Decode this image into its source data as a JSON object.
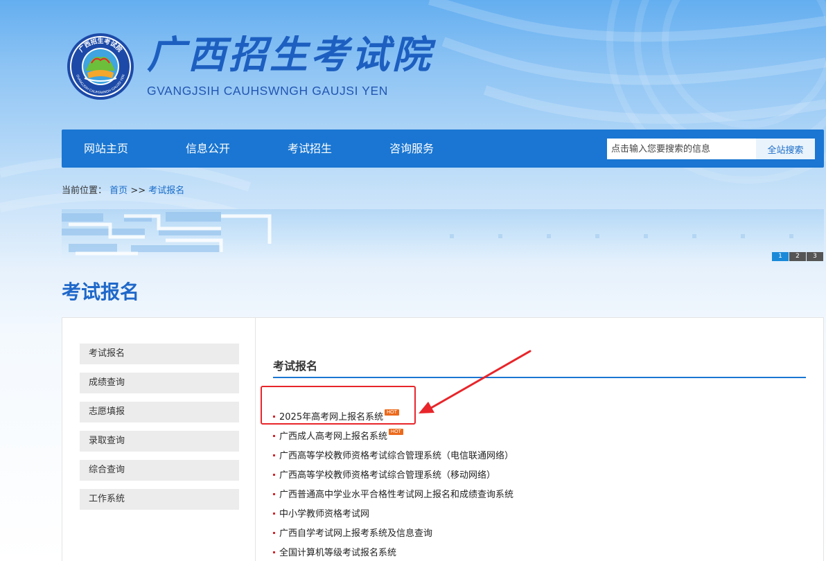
{
  "header": {
    "title": "广西招生考试院",
    "subtitle": "GVANGJSIH CAUHSWNGH GAUJSI YEN",
    "seal_text": "广西招生考试院",
    "seal_sub_text": "GVANGJSIH CAUHSWNGH GAUJSI YEN"
  },
  "nav": {
    "items": [
      {
        "label": "网站主页"
      },
      {
        "label": "信息公开"
      },
      {
        "label": "考试招生"
      },
      {
        "label": "咨询服务"
      }
    ],
    "search_placeholder": "点击输入您要搜索的信息",
    "search_button": "全站搜索"
  },
  "breadcrumb": {
    "prefix": "当前位置：",
    "home": "首页",
    "separator": ">>",
    "current": "考试报名"
  },
  "banner": {
    "pages": [
      "1",
      "2",
      "3"
    ],
    "active_page": "1"
  },
  "page_title": "考试报名",
  "sidebar": {
    "items": [
      {
        "label": "考试报名"
      },
      {
        "label": "成绩查询"
      },
      {
        "label": "志愿填报"
      },
      {
        "label": "录取查询"
      },
      {
        "label": "综合查询"
      },
      {
        "label": "工作系统"
      }
    ]
  },
  "main": {
    "section_title": "考试报名",
    "hot_label": "HOT",
    "links": [
      {
        "label": "2025年高考网上报名系统",
        "hot": true
      },
      {
        "label": "广西成人高考网上报名系统",
        "hot": true
      },
      {
        "label": "广西高等学校教师资格考试综合管理系统（电信联通网络）",
        "hot": false
      },
      {
        "label": "广西高等学校教师资格考试综合管理系统（移动网络）",
        "hot": false
      },
      {
        "label": "广西普通高中学业水平合格性考试网上报名和成绩查询系统",
        "hot": false
      },
      {
        "label": "中小学教师资格考试网",
        "hot": false
      },
      {
        "label": "广西自学考试网上报考系统及信息查询",
        "hot": false
      },
      {
        "label": "全国计算机等级考试报名系统",
        "hot": false
      }
    ]
  },
  "colors": {
    "brand_blue": "#1a76d2",
    "title_blue": "#1f68c9",
    "hot_orange": "#ec6a1c",
    "annotation_red": "#e8252a"
  }
}
